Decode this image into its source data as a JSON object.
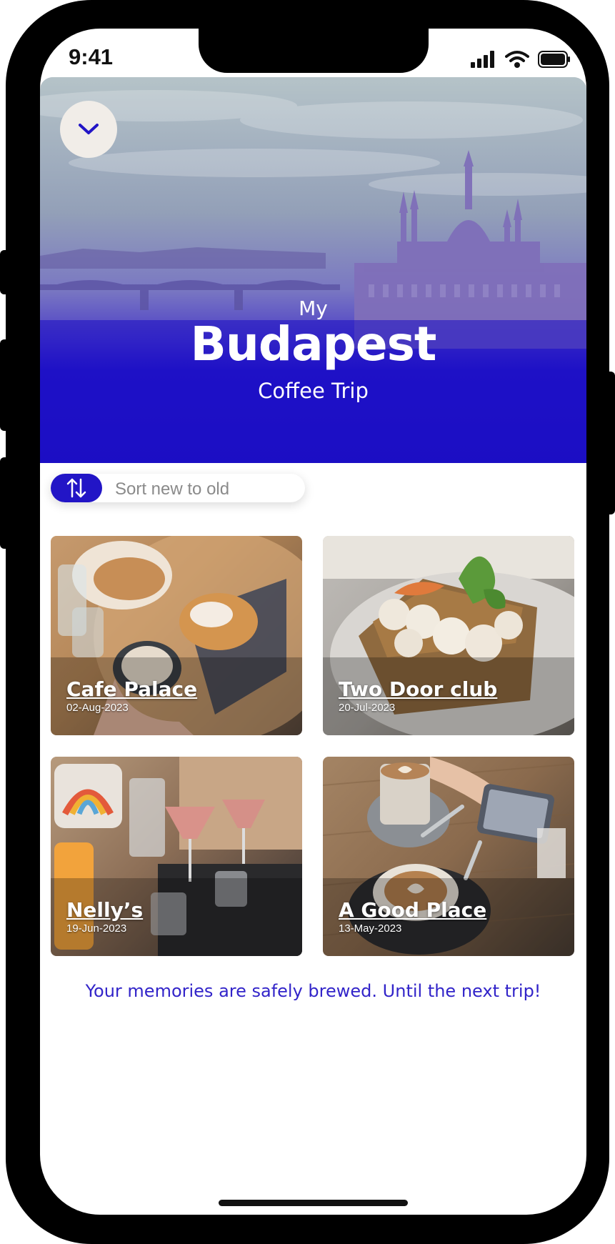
{
  "status_bar": {
    "time": "9:41"
  },
  "hero": {
    "line1": "My",
    "title": "Budapest",
    "subtitle": "Coffee Trip"
  },
  "sort": {
    "label": "Sort new to old"
  },
  "cards": [
    {
      "name": "Cafe Palace",
      "date": "02-Aug-2023"
    },
    {
      "name": "Two Door club",
      "date": "20-Jul-2023"
    },
    {
      "name": "Nelly’s",
      "date": "19-Jun-2023"
    },
    {
      "name": "A Good Place",
      "date": "13-May-2023"
    }
  ],
  "footer": {
    "message": "Your memories are safely brewed. Until the next trip!"
  },
  "colors": {
    "accent": "#2215c6",
    "footer_text": "#3224c9"
  }
}
